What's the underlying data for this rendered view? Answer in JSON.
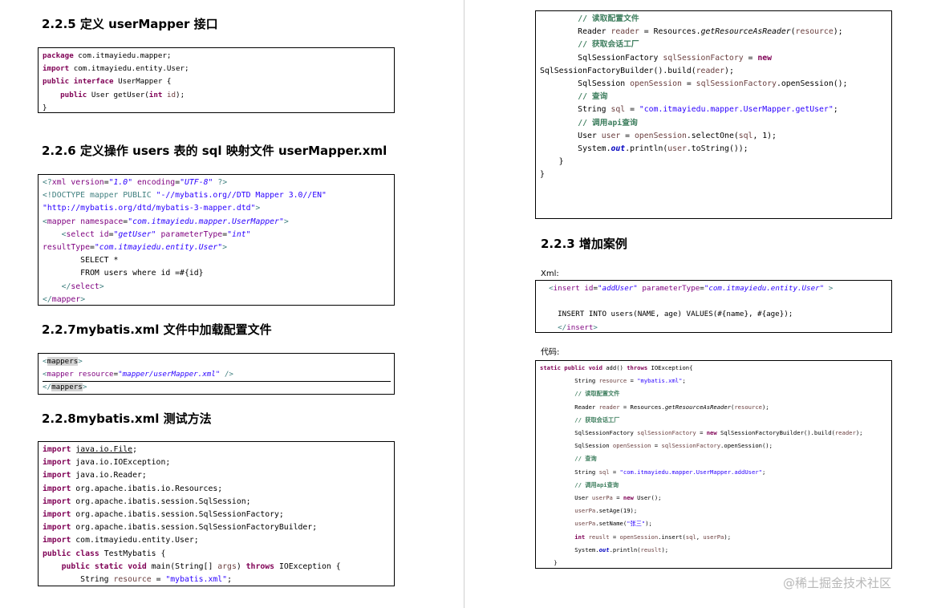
{
  "headings": {
    "h1": "2.2.5 定义 userMapper 接口",
    "h2": "2.2.6 定义操作 users 表的 sql 映射文件 userMapper.xml",
    "h3": "2.2.7mybatis.xml 文件中加载配置文件",
    "h4": "2.2.8mybatis.xml 测试方法",
    "h5": "2.2.3 增加案例"
  },
  "labels": {
    "xml": "Xml:",
    "code": "代码:"
  },
  "watermark": "@稀土掘金技术社区",
  "code": {
    "interface": [
      [
        [
          "kw",
          "package"
        ],
        [
          "tx",
          " com.itmayiedu.mapper;"
        ]
      ],
      [
        [
          "kw",
          "import"
        ],
        [
          "tx",
          " com.itmayiedu.entity.User;"
        ]
      ],
      [
        [
          "kw",
          "public"
        ],
        [
          "tx",
          " "
        ],
        [
          "kw",
          "interface"
        ],
        [
          "tx",
          " UserMapper {"
        ]
      ],
      [
        [
          "tx",
          "    "
        ],
        [
          "kw",
          "public"
        ],
        [
          "tx",
          " User getUser("
        ],
        [
          "kw",
          "int"
        ],
        [
          "tx",
          " "
        ],
        [
          "vr",
          "id"
        ],
        [
          "tx",
          ");"
        ]
      ],
      [
        [
          "tx",
          "}"
        ]
      ]
    ],
    "mapperXml": [
      [
        [
          "tg",
          "<?"
        ],
        [
          "at",
          "xml"
        ],
        [
          "tx",
          " "
        ],
        [
          "at",
          "version"
        ],
        [
          "tx",
          "="
        ],
        [
          "it",
          "\"1.0\""
        ],
        [
          "tx",
          " "
        ],
        [
          "at",
          "encoding"
        ],
        [
          "tx",
          "="
        ],
        [
          "it",
          "\"UTF-8\""
        ],
        [
          "tx",
          " "
        ],
        [
          "tg",
          "?>"
        ]
      ],
      [
        [
          "tg",
          "<!DOCTYPE mapper PUBLIC "
        ],
        [
          "st",
          "\"-//mybatis.org//DTD Mapper 3.0//EN\""
        ]
      ],
      [
        [
          "st",
          "\"http://mybatis.org/dtd/mybatis-3-mapper.dtd\""
        ],
        [
          "tg",
          ">"
        ]
      ],
      [
        [
          "tg",
          "<"
        ],
        [
          "at",
          "mapper"
        ],
        [
          "tx",
          " "
        ],
        [
          "at",
          "namespace"
        ],
        [
          "tx",
          "="
        ],
        [
          "it",
          "\"com.itmayiedu.mapper.UserMapper\""
        ],
        [
          "tg",
          ">"
        ]
      ],
      [
        [
          "tx",
          "    "
        ],
        [
          "tg",
          "<"
        ],
        [
          "at",
          "select"
        ],
        [
          "tx",
          " "
        ],
        [
          "at",
          "id"
        ],
        [
          "tx",
          "="
        ],
        [
          "it",
          "\"getUser\""
        ],
        [
          "tx",
          " "
        ],
        [
          "at",
          "parameterType"
        ],
        [
          "tx",
          "="
        ],
        [
          "it",
          "\"int\""
        ]
      ],
      [
        [
          "at",
          "resultType"
        ],
        [
          "tx",
          "="
        ],
        [
          "it",
          "\"com.itmayiedu.entity.User\""
        ],
        [
          "tg",
          ">"
        ]
      ],
      [
        [
          "tx",
          "        SELECT *"
        ]
      ],
      [
        [
          "tx",
          "        FROM users where id =#{id}"
        ]
      ],
      [
        [
          "tx",
          "    "
        ],
        [
          "tg",
          "</"
        ],
        [
          "at",
          "select"
        ],
        [
          "tg",
          ">"
        ]
      ],
      [
        [
          "tg",
          "</"
        ],
        [
          "at",
          "mapper"
        ],
        [
          "tg",
          ">"
        ]
      ]
    ],
    "configXml": [
      [
        [
          "tg",
          "<"
        ],
        [
          "hl",
          "mappers"
        ],
        [
          "tg",
          ">"
        ]
      ],
      [
        [
          "tg",
          "<"
        ],
        [
          "at",
          "mapper"
        ],
        [
          "tx",
          " "
        ],
        [
          "at",
          "resource"
        ],
        [
          "tx",
          "="
        ],
        [
          "it",
          "\"mapper/userMapper.xml\""
        ],
        [
          "tx",
          " "
        ],
        [
          "tg",
          "/>"
        ]
      ],
      [
        [
          "tg",
          "</"
        ],
        [
          "hl",
          "mappers"
        ],
        [
          "tg",
          ">"
        ]
      ]
    ],
    "testImports": [
      [
        [
          "kw",
          "import"
        ],
        [
          "tx",
          " "
        ],
        [
          "ul",
          "java.io.File"
        ],
        [
          "tx",
          ";"
        ]
      ],
      [
        [
          "kw",
          "import"
        ],
        [
          "tx",
          " java.io.IOException;"
        ]
      ],
      [
        [
          "kw",
          "import"
        ],
        [
          "tx",
          " java.io.Reader;"
        ]
      ],
      [
        [
          "kw",
          "import"
        ],
        [
          "tx",
          " org.apache.ibatis.io.Resources;"
        ]
      ],
      [
        [
          "kw",
          "import"
        ],
        [
          "tx",
          " org.apache.ibatis.session.SqlSession;"
        ]
      ],
      [
        [
          "kw",
          "import"
        ],
        [
          "tx",
          " org.apache.ibatis.session.SqlSessionFactory;"
        ]
      ],
      [
        [
          "kw",
          "import"
        ],
        [
          "tx",
          " org.apache.ibatis.session.SqlSessionFactoryBuilder;"
        ]
      ],
      [
        [
          "kw",
          "import"
        ],
        [
          "tx",
          " com.itmayiedu.entity.User;"
        ]
      ],
      [
        [
          "kw",
          "public"
        ],
        [
          "tx",
          " "
        ],
        [
          "kw",
          "class"
        ],
        [
          "tx",
          " TestMybatis {"
        ]
      ],
      [
        [
          "tx",
          "    "
        ],
        [
          "kw",
          "public"
        ],
        [
          "tx",
          " "
        ],
        [
          "kw",
          "static"
        ],
        [
          "tx",
          " "
        ],
        [
          "kw",
          "void"
        ],
        [
          "tx",
          " main(String[] "
        ],
        [
          "vr",
          "args"
        ],
        [
          "tx",
          ") "
        ],
        [
          "kw",
          "throws"
        ],
        [
          "tx",
          " IOException {"
        ]
      ],
      [
        [
          "tx",
          "        String "
        ],
        [
          "vr",
          "resource"
        ],
        [
          "tx",
          " = "
        ],
        [
          "st",
          "\"mybatis.xml\""
        ],
        [
          "tx",
          ";"
        ]
      ]
    ],
    "testBody": [
      [
        [
          "tx",
          "        "
        ],
        [
          "cm",
          "// 读取配置文件"
        ]
      ],
      [
        [
          "tx",
          "        Reader "
        ],
        [
          "vr",
          "reader"
        ],
        [
          "tx",
          " = Resources."
        ],
        [
          "mi",
          "getResourceAsReader"
        ],
        [
          "tx",
          "("
        ],
        [
          "vr",
          "resource"
        ],
        [
          "tx",
          ");"
        ]
      ],
      [
        [
          "tx",
          "        "
        ],
        [
          "cm",
          "// 获取会话工厂"
        ]
      ],
      [
        [
          "tx",
          "        SqlSessionFactory "
        ],
        [
          "vr",
          "sqlSessionFactory"
        ],
        [
          "tx",
          " = "
        ],
        [
          "kw",
          "new"
        ]
      ],
      [
        [
          "tx",
          "SqlSessionFactoryBuilder().build("
        ],
        [
          "vr",
          "reader"
        ],
        [
          "tx",
          ");"
        ]
      ],
      [
        [
          "tx",
          "        SqlSession "
        ],
        [
          "vr",
          "openSession"
        ],
        [
          "tx",
          " = "
        ],
        [
          "vr",
          "sqlSessionFactory"
        ],
        [
          "tx",
          ".openSession();"
        ]
      ],
      [
        [
          "tx",
          "        "
        ],
        [
          "cm",
          "// 查询"
        ]
      ],
      [
        [
          "tx",
          "        String "
        ],
        [
          "vr",
          "sql"
        ],
        [
          "tx",
          " = "
        ],
        [
          "st",
          "\"com.itmayiedu.mapper.UserMapper.getUser\""
        ],
        [
          "tx",
          ";"
        ]
      ],
      [
        [
          "tx",
          "        "
        ],
        [
          "cm",
          "// 调用"
        ],
        [
          "cm",
          "api"
        ],
        [
          "cm",
          "查询"
        ]
      ],
      [
        [
          "tx",
          "        User "
        ],
        [
          "vr",
          "user"
        ],
        [
          "tx",
          " = "
        ],
        [
          "vr",
          "openSession"
        ],
        [
          "tx",
          ".selectOne("
        ],
        [
          "vr",
          "sql"
        ],
        [
          "tx",
          ", 1);"
        ]
      ],
      [
        [
          "tx",
          "        System."
        ],
        [
          "fd",
          "out"
        ],
        [
          "tx",
          ".println("
        ],
        [
          "vr",
          "user"
        ],
        [
          "tx",
          ".toString());"
        ]
      ],
      [
        [
          "tx",
          "    }"
        ]
      ],
      [
        [
          "tx",
          "}"
        ]
      ]
    ],
    "insertXml": [
      [
        [
          "tx",
          "  "
        ],
        [
          "tg",
          "<"
        ],
        [
          "at",
          "insert"
        ],
        [
          "tx",
          " "
        ],
        [
          "at",
          "id"
        ],
        [
          "tx",
          "="
        ],
        [
          "it",
          "\"addUser\""
        ],
        [
          "tx",
          " "
        ],
        [
          "at",
          "parameterType"
        ],
        [
          "tx",
          "="
        ],
        [
          "it",
          "\"com.itmayiedu.entity.User\""
        ],
        [
          "tx",
          " "
        ],
        [
          "tg",
          ">"
        ]
      ],
      [
        [
          "tx",
          " "
        ]
      ],
      [
        [
          "tx",
          "    INSERT INTO users(NAME, age) VALUES(#{name}, #{age});"
        ]
      ],
      [
        [
          "tx",
          "    "
        ],
        [
          "tg",
          "</"
        ],
        [
          "at",
          "insert"
        ],
        [
          "tg",
          ">"
        ]
      ]
    ],
    "insertCode": [
      [
        [
          "kw",
          "static"
        ],
        [
          "tx",
          " "
        ],
        [
          "kw",
          "public"
        ],
        [
          "tx",
          " "
        ],
        [
          "kw",
          "void"
        ],
        [
          "tx",
          " add() "
        ],
        [
          "kw",
          "throws"
        ],
        [
          "tx",
          " IOException{"
        ]
      ],
      [
        [
          "tx",
          "          String "
        ],
        [
          "vr",
          "resource"
        ],
        [
          "tx",
          " = "
        ],
        [
          "st",
          "\"mybatis.xml\""
        ],
        [
          "tx",
          ";"
        ]
      ],
      [
        [
          "tx",
          "          "
        ],
        [
          "cm",
          "// 读取配置文件"
        ]
      ],
      [
        [
          "tx",
          "          Reader "
        ],
        [
          "vr",
          "reader"
        ],
        [
          "tx",
          " = Resources."
        ],
        [
          "mi",
          "getResourceAsReader"
        ],
        [
          "tx",
          "("
        ],
        [
          "vr",
          "resource"
        ],
        [
          "tx",
          ");"
        ]
      ],
      [
        [
          "tx",
          "          "
        ],
        [
          "cm",
          "// 获取会话工厂"
        ]
      ],
      [
        [
          "tx",
          "          SqlSessionFactory "
        ],
        [
          "vr",
          "sqlSessionFactory"
        ],
        [
          "tx",
          " = "
        ],
        [
          "kw",
          "new"
        ],
        [
          "tx",
          " SqlSessionFactoryBuilder().build("
        ],
        [
          "vr",
          "reader"
        ],
        [
          "tx",
          ");"
        ]
      ],
      [
        [
          "tx",
          "          SqlSession "
        ],
        [
          "vr",
          "openSession"
        ],
        [
          "tx",
          " = "
        ],
        [
          "vr",
          "sqlSessionFactory"
        ],
        [
          "tx",
          ".openSession();"
        ]
      ],
      [
        [
          "tx",
          "          "
        ],
        [
          "cm",
          "// 查询"
        ]
      ],
      [
        [
          "tx",
          "          String "
        ],
        [
          "vr",
          "sql"
        ],
        [
          "tx",
          " = "
        ],
        [
          "st",
          "\"com.itmayiedu.mapper.UserMapper.addUser\""
        ],
        [
          "tx",
          ";"
        ]
      ],
      [
        [
          "tx",
          "          "
        ],
        [
          "cm",
          "// 调用"
        ],
        [
          "cm",
          "api"
        ],
        [
          "cm",
          "查询"
        ]
      ],
      [
        [
          "tx",
          "          User "
        ],
        [
          "vr",
          "userPa"
        ],
        [
          "tx",
          " = "
        ],
        [
          "kw",
          "new"
        ],
        [
          "tx",
          " User();"
        ]
      ],
      [
        [
          "tx",
          "          "
        ],
        [
          "vr",
          "userPa"
        ],
        [
          "tx",
          ".setAge(19);"
        ]
      ],
      [
        [
          "tx",
          "          "
        ],
        [
          "vr",
          "userPa"
        ],
        [
          "tx",
          ".setName("
        ],
        [
          "st",
          "\"张三\""
        ],
        [
          "tx",
          ");"
        ]
      ],
      [
        [
          "tx",
          "          "
        ],
        [
          "kw",
          "int"
        ],
        [
          "tx",
          " "
        ],
        [
          "vr",
          "reuslt"
        ],
        [
          "tx",
          " = "
        ],
        [
          "vr",
          "openSession"
        ],
        [
          "tx",
          ".insert("
        ],
        [
          "vr",
          "sql"
        ],
        [
          "tx",
          ", "
        ],
        [
          "vr",
          "userPa"
        ],
        [
          "tx",
          ");"
        ]
      ],
      [
        [
          "tx",
          "          System."
        ],
        [
          "fd",
          "out"
        ],
        [
          "tx",
          ".println("
        ],
        [
          "vr",
          "reuslt"
        ],
        [
          "tx",
          ");"
        ]
      ],
      [
        [
          "tx",
          "    }"
        ]
      ]
    ]
  }
}
